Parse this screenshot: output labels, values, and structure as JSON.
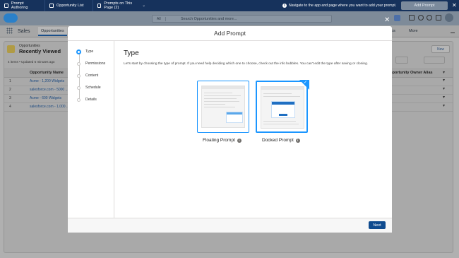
{
  "topbar": {
    "items": [
      {
        "label": "Prompt Authoring"
      },
      {
        "label": "Opportunity List"
      },
      {
        "label": "Prompts on This Page (2)"
      }
    ],
    "info_text": "Navigate to the app and page where you want to add your prompt.",
    "add_prompt_label": "Add Prompt",
    "close_glyph": "✕"
  },
  "header": {
    "search_scope": "All",
    "search_placeholder": "Search Opportunities and more..."
  },
  "nav": {
    "app_name": "Sales",
    "active_tab": "Opportunities",
    "right_items": [
      "aps",
      "More"
    ]
  },
  "list": {
    "object_type": "Opportunities",
    "view_name": "Recently Viewed",
    "meta": "4 items • Updated 5 minutes ago",
    "new_label": "New",
    "columns": [
      "Opportunity Name",
      "Opportunity Owner Alias"
    ],
    "rows": [
      {
        "num": "1",
        "name": "Acme - 1,200 Widgets"
      },
      {
        "num": "2",
        "name": "salesforce.com - 5000 ..."
      },
      {
        "num": "3",
        "name": "Acme - 600 Widgets"
      },
      {
        "num": "4",
        "name": "salesforce.com - 1,000 ..."
      }
    ]
  },
  "modal": {
    "title": "Add Prompt",
    "close_glyph": "✕",
    "steps": [
      "Type",
      "Permissions",
      "Content",
      "Schedule",
      "Details"
    ],
    "heading": "Type",
    "description": "Let's start by choosing the type of prompt. If you need help deciding which one to choose, check out the info bubbles. You can't edit the type after saving or cloning.",
    "options": [
      {
        "label": "Floating Prompt",
        "icon": "info-icon"
      },
      {
        "label": "Docked Prompt",
        "icon": "info-icon",
        "selected": true
      }
    ],
    "next_label": "Next"
  },
  "colors": {
    "accent": "#1b96ff",
    "brand_dark": "#16325c",
    "button": "#0f4b8f"
  }
}
